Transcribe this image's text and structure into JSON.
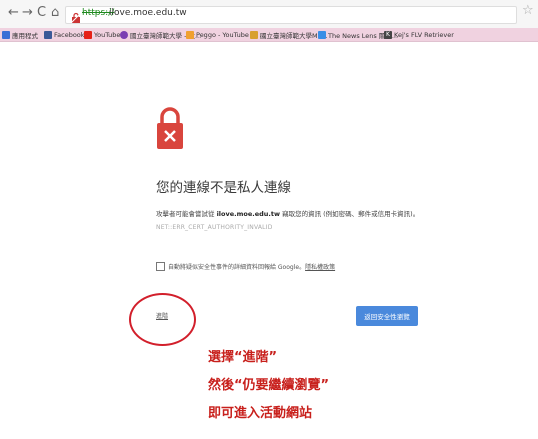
{
  "browser": {
    "nav": {
      "back": "←",
      "forward": "→",
      "reload": "C",
      "home": "⌂"
    },
    "url": {
      "scheme": "https://",
      "host": "ilove.moe.edu.tw"
    },
    "star": "☆"
  },
  "bookmarks": [
    {
      "label": "應用程式",
      "icon": "apps-grid-icon",
      "color": "#3b6fd6"
    },
    {
      "label": "Facebook",
      "icon": "facebook-icon",
      "color": "#3b5998"
    },
    {
      "label": "YouTube",
      "icon": "youtube-icon",
      "color": "#e62117"
    },
    {
      "label": "國立臺灣師範大學 - 大...",
      "icon": "university-icon",
      "color": "#7b3fb2"
    },
    {
      "label": "Peggo - YouTube to ...",
      "icon": "peggo-icon",
      "color": "#f0a030"
    },
    {
      "label": "國立臺灣師範大學Mo...",
      "icon": "university-icon",
      "color": "#d8a030"
    },
    {
      "label": "The News Lens 關鍵...",
      "icon": "newslens-icon",
      "color": "#3a8ee6"
    },
    {
      "label": "Kej's FLV Retriever",
      "icon": "k-icon",
      "color": "#444444"
    }
  ],
  "page": {
    "title": "您的連線不是私人連線",
    "desc_pre": "攻擊者可能會嘗試從 ",
    "desc_host": "ilove.moe.edu.tw",
    "desc_post": " 竊取您的資訊 (例如密碼、郵件或信用卡資訊)。",
    "error_code": "NET::ERR_CERT_AUTHORITY_INVALID",
    "checkbox_text": "自動將疑似安全性事件的詳細資料回報給 Google。",
    "privacy_link": "隱私權政策",
    "advanced_link": "進階",
    "back_button": "返回安全性瀏覽"
  },
  "annotations": {
    "line1": "選擇“進階”",
    "line2": "然後“仍要繼續瀏覽”",
    "line3": "即可進入活動網站",
    "color": "#c8201c"
  },
  "colors": {
    "error_red": "#d9453d",
    "button_blue": "#4a89dc"
  }
}
